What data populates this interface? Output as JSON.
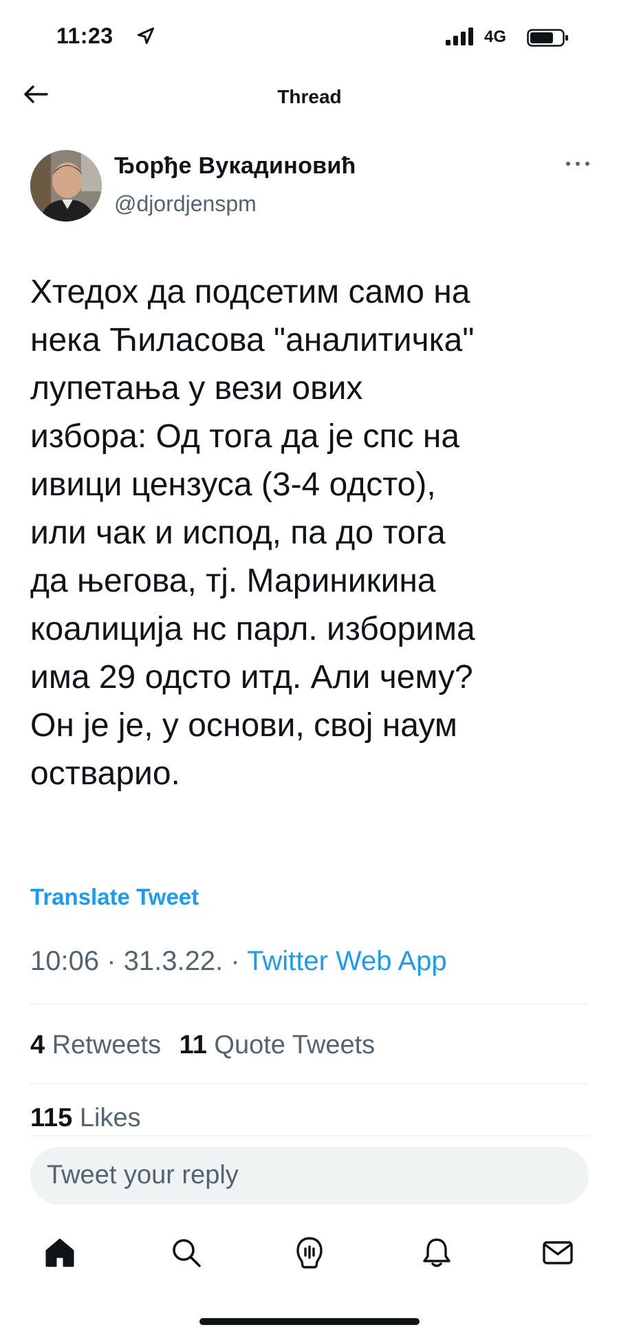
{
  "status_bar": {
    "time": "11:23",
    "network": "4G"
  },
  "nav": {
    "title": "Thread"
  },
  "author": {
    "name": "Ђорђе Вукадиновић",
    "handle": "@djordjenspm"
  },
  "tweet": {
    "text": "Хтедох да подсетим само на\nнека Ћиласова \"аналитичка\"\nлупетања у вези ових\nизбора: Од тога да је спс на\nивици цензуса (3-4 одсто),\nили чак и испод, па до тога\nда његова, тј. Мариникина\nкоалиција нс парл. изборима\nима 29 одсто итд. Али чему?\nОн је је, у основи, свој наум\nостварио.",
    "translate_label": "Translate Tweet",
    "time": "10:06",
    "date": "31.3.22.",
    "separator": "·",
    "source": "Twitter Web App"
  },
  "stats": {
    "retweets_count": "4",
    "retweets_label": "Retweets",
    "quotes_count": "11",
    "quotes_label": "Quote Tweets",
    "likes_count": "115",
    "likes_label": "Likes"
  },
  "reply": {
    "placeholder": "Tweet your reply"
  },
  "tabs": [
    {
      "icon": "home-icon"
    },
    {
      "icon": "search-icon"
    },
    {
      "icon": "spaces-icon"
    },
    {
      "icon": "bell-icon"
    },
    {
      "icon": "mail-icon"
    }
  ],
  "colors": {
    "accent": "#1d9bf0",
    "text": "#0f1419",
    "secondary": "#536471",
    "input_bg": "#eff3f4"
  }
}
